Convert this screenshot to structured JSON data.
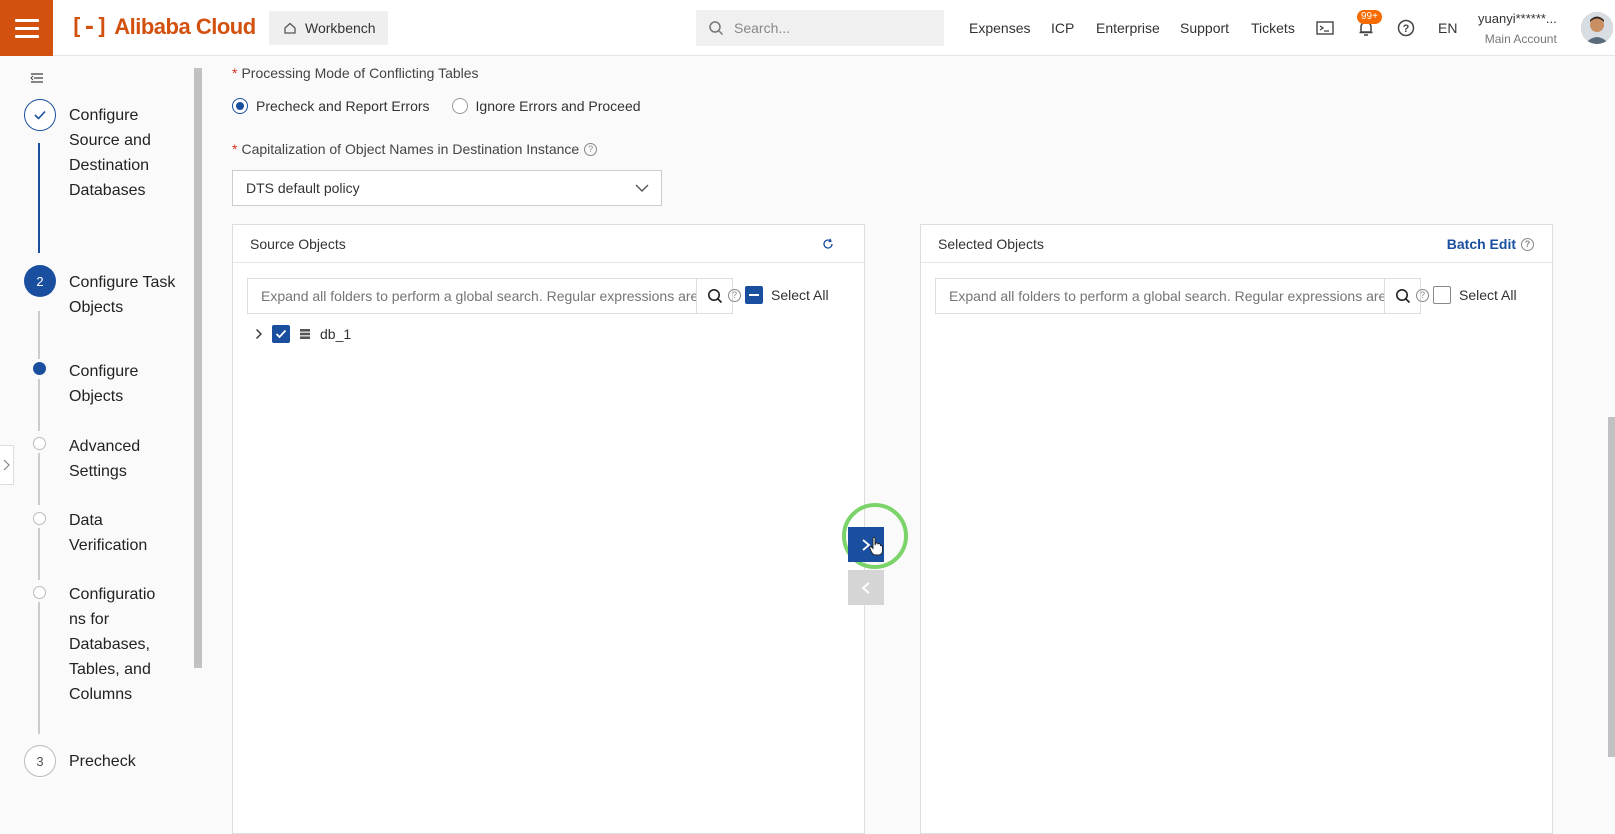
{
  "header": {
    "brand": "Alibaba Cloud",
    "brand_mark": "[-]",
    "workbench": "Workbench",
    "search_placeholder": "Search...",
    "nav": [
      "Expenses",
      "ICP",
      "Enterprise",
      "Support",
      "Tickets"
    ],
    "notification_badge": "99+",
    "language": "EN",
    "user_name": "yuanyi******...",
    "user_role": "Main Account",
    "accent_color": "#d2510f"
  },
  "steps": [
    {
      "label_lines": [
        "Configure",
        "Source and",
        "Destination",
        "Databases"
      ],
      "state": "done"
    },
    {
      "number": "2",
      "label_lines": [
        "Configure Task",
        "Objects"
      ],
      "state": "active"
    },
    {
      "label_lines": [
        "Configure",
        "Objects"
      ],
      "state": "current-sub"
    },
    {
      "label_lines": [
        "Advanced",
        "Settings"
      ],
      "state": "pending-sub"
    },
    {
      "label_lines": [
        "Data",
        "Verification"
      ],
      "state": "pending-sub"
    },
    {
      "label_lines": [
        "Configuratio",
        "ns for",
        "Databases,",
        "Tables, and",
        "Columns"
      ],
      "state": "pending-sub"
    },
    {
      "number": "3",
      "label_lines": [
        "Precheck"
      ],
      "state": "pending"
    }
  ],
  "form": {
    "conflict_label": "Processing Mode of Conflicting Tables",
    "conflict_options": [
      "Precheck and Report Errors",
      "Ignore Errors and Proceed"
    ],
    "conflict_selected": "Precheck and Report Errors",
    "capitalization_label": "Capitalization of Object Names in Destination Instance",
    "capitalization_value": "DTS default policy"
  },
  "source_panel": {
    "title": "Source Objects",
    "search_placeholder": "Expand all folders to perform a global search. Regular expressions are supported.",
    "select_all": "Select All",
    "tree": [
      {
        "name": "db_1",
        "checked": true
      }
    ]
  },
  "selected_panel": {
    "title": "Selected Objects",
    "batch_edit": "Batch Edit",
    "search_placeholder": "Expand all folders to perform a global search. Regular expressions are supported.",
    "select_all": "Select All"
  },
  "colors": {
    "primary": "#1a4fa0",
    "highlight": "#7bd46a"
  }
}
